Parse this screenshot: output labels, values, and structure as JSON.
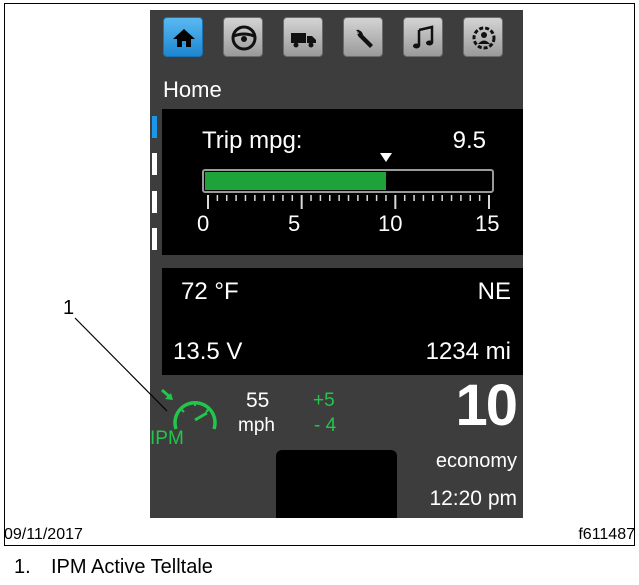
{
  "display": {
    "tabs": [
      {
        "icon": "home-icon",
        "active": true
      },
      {
        "icon": "steering-wheel-icon",
        "active": false
      },
      {
        "icon": "truck-icon",
        "active": false
      },
      {
        "icon": "wrench-icon",
        "active": false
      },
      {
        "icon": "music-note-icon",
        "active": false
      },
      {
        "icon": "settings-icon",
        "active": false
      }
    ],
    "screen_title": "Home",
    "page_indicator": {
      "count": 4,
      "active_index": 0
    },
    "trip": {
      "label": "Trip mpg:",
      "value": "9.5",
      "scale_labels": [
        "0",
        "5",
        "10",
        "15"
      ],
      "scale_max": 15,
      "current_mpg": 9.5,
      "pointer_mpg": 9.5
    },
    "info": {
      "temperature": "72 °F",
      "heading": "NE",
      "voltage": "13.5 V",
      "odometer": "1234 mi"
    },
    "cruise": {
      "ipm_label": "IPM",
      "speed": "55",
      "unit": "mph",
      "upper_offset": "+5",
      "lower_offset": "- 4"
    },
    "economy_value": "10",
    "economy_label": "economy",
    "clock": "12:20 pm"
  },
  "figure": {
    "callout_number": "1",
    "date": "09/11/2017",
    "figure_id": "f611487",
    "caption_number": "1.",
    "caption_text": "IPM Active Telltale"
  },
  "colors": {
    "display_bg": "#3d3d3d",
    "active_tab": "#2a9be0",
    "bar_green": "#1ea23a",
    "ipm_green": "#22c64a"
  }
}
